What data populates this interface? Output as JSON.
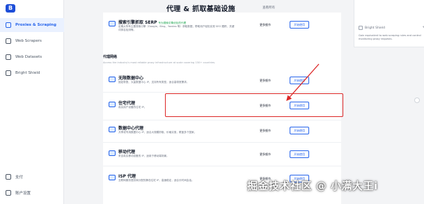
{
  "sidebar": {
    "logo": "B",
    "items": [
      {
        "label": "Proxies & Scraping",
        "active": true
      },
      {
        "label": "Web Scrapers"
      },
      {
        "label": "Web Datasets"
      },
      {
        "label": "Bright Shield"
      }
    ],
    "bottom": [
      {
        "label": "支付"
      },
      {
        "label": "账户设置"
      }
    ]
  },
  "header": {
    "title": "代理 & 抓取基础设施",
    "link": "查看所有"
  },
  "serp": {
    "title": "搜索引擎抓取 SERP",
    "tag": "专为搜索引擎优化的代理",
    "desc": "定期从所有主要搜索引擎（Google、Bing、Yandex 等）获取数据，帮助用户轻松实现 SEO 跟踪、关键词排名检测等。",
    "more": "更多细节",
    "btn": "开始使用"
  },
  "section": {
    "title": "代理网络",
    "desc": "Access the industry's most reliable proxy infrastructure at scale covering 150+ countries."
  },
  "rows": [
    {
      "title": "无限数据中心",
      "desc": "固定带宽、大量数据中心 IP，支持所有类型，适合高带宽需求。",
      "more": "更多细节",
      "btn": "开始使用"
    },
    {
      "title": "住宅代理",
      "desc": "真实用户设备的住宅 IP。",
      "more": "更多细节",
      "btn": "开始使用"
    },
    {
      "title": "数据中心代理",
      "desc": "共享或专用数据中心 IP，适合大规模抓取，价格实惠，覆盖多个国家。",
      "more": "更多细节",
      "btn": "开始使用"
    },
    {
      "title": "移动代理",
      "desc": "来自真实移动设备的 IP，适用于移动端场景。",
      "more": "更多细节",
      "btn": "开始使用"
    },
    {
      "title": "ISP 代理",
      "desc": "互联网服务提供商分配的静态住宅 IP，高速稳定，适合长时间会话。",
      "more": "更多细节",
      "btn": "开始使用"
    }
  ],
  "card": {
    "title": "Bright Shield",
    "desc": "Gain equivalent to web scraping rules and control monitoring proxy requests."
  },
  "watermark": "掘金技术社区 @ 小满大王i"
}
